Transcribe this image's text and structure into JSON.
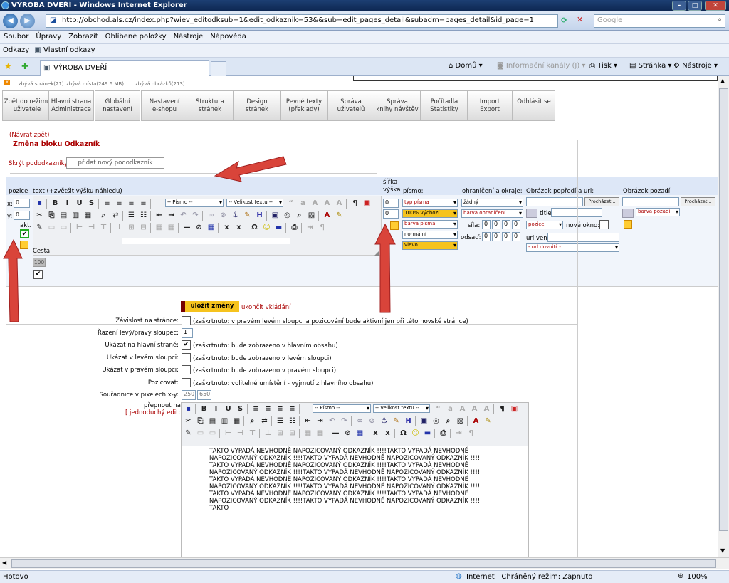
{
  "window": {
    "title": "VÝROBA DVEŘÍ - Windows Internet Explorer"
  },
  "address": {
    "url": "http://obchod.als.cz/index.php?wiev_editodksub=1&edit_odkaznik=53&&sub=edit_pages_detail&subadm=pages_detail&id_page=1",
    "search_placeholder": "Google"
  },
  "menu": [
    "Soubor",
    "Úpravy",
    "Zobrazit",
    "Oblíbené položky",
    "Nástroje",
    "Nápověda"
  ],
  "links_bar": {
    "label": "Odkazy",
    "item": "Vlastní odkazy"
  },
  "tabs": {
    "active": "VÝROBA DVEŘÍ"
  },
  "commands": {
    "home": "Domů",
    "feeds": "Informační kanály (J)",
    "print": "Tisk",
    "page": "Stránka",
    "tools": "Nástroje"
  },
  "quota": {
    "pages": "zbývá stránek(21)",
    "space": "zbývá místa(249.6 MB)",
    "images": "zbývá obrázků(213)"
  },
  "admin_menu": [
    {
      "l1": "Zpět do režimu",
      "l2": "uživatele"
    },
    {
      "l1": "Hlavní strana",
      "l2": "Administrace"
    },
    {
      "l1": "Globální",
      "l2": "nastavení"
    },
    {
      "l1": "Nastavení",
      "l2": "e-shopu"
    },
    {
      "l1": "Struktura",
      "l2": "stránek"
    },
    {
      "l1": "Design",
      "l2": "stránek"
    },
    {
      "l1": "Pevné texty",
      "l2": "(překlady)"
    },
    {
      "l1": "Správa",
      "l2": "uživatelů"
    },
    {
      "l1": "Správa",
      "l2": "knihy návštěv"
    },
    {
      "l1": "Počítadla",
      "l2": "Statistiky"
    },
    {
      "l1": "Import",
      "l2": "Export"
    },
    {
      "l1": "Odhlásit se",
      "l2": ""
    }
  ],
  "form": {
    "back": "(Návrat zpět)",
    "heading": "Změna bloku Odkazník",
    "hide_sub": "Skrýt pododkazníky |",
    "add_sub": "přidat nový pododkazník",
    "hdr_pozice": "pozice",
    "hdr_text": "text (+zvětšit výšku náhledu)",
    "hdr_sirka": "šířka",
    "hdr_vyska": "výška",
    "hdr_pismo": "písmo:",
    "hdr_ohraniceni": "ohraničení a okraje:",
    "hdr_obr_popredi": "Obrázek popředí a url:",
    "hdr_obr_pozadi": "Obrázek pozadí:",
    "x_label": "x:",
    "x_val": "0",
    "y_label": "y:",
    "y_val": "0",
    "akt": "akt.",
    "sirka_val": "0",
    "vyska_val": "0",
    "font_type": "typ písma",
    "font_size": "100% Výchozí",
    "font_color": "barva písma",
    "font_weight": "normální",
    "font_align": "vlevo",
    "border_none": "žádný",
    "border_color": "barva ohraničení",
    "sila": "síla:",
    "odsad": "odsaď:",
    "sila_vals": [
      "0",
      "0",
      "0",
      "0"
    ],
    "odsad_vals": [
      "0",
      "0",
      "0",
      "0"
    ],
    "browse": "Procházet...",
    "title_lbl": "title:",
    "pozice_sel": "pozice",
    "nove_okno": "nové okno:",
    "url_ven": "url ven:",
    "url_dovnitr": "- url dovnitř -",
    "bg_color": "barva pozadí",
    "font_combo": "-- Písmo --",
    "size_combo": "-- Velikost textu --",
    "cesta": "Cesta:",
    "hundred": "100"
  },
  "save": {
    "save_btn": "uložit změny",
    "cancel": "ukončit vkládání"
  },
  "settings": [
    {
      "label": "Závislost na stránce:",
      "desc": "(zaškrtnuto: v pravém levém sloupci a pozicování bude aktivní jen při této hovské stránce)"
    },
    {
      "label": "Řazení levý/pravý sloupec:",
      "value": "1"
    },
    {
      "label": "Ukázat na hlavní straně:",
      "desc": "(zaškrtnuto: bude zobrazeno v hlavním obsahu)"
    },
    {
      "label": "Ukázat v levém sloupci:",
      "desc": "(zaškrtnuto: bude zobrazeno v levém sloupci)"
    },
    {
      "label": "Ukázat v pravém sloupci:",
      "desc": "(zaškrtnuto: bude zobrazeno v pravém sloupci)"
    },
    {
      "label": "Pozicovat:",
      "desc": "(zaškrtnuto: volitelné umístění - vyjmutí z hlavního obsahu)"
    },
    {
      "label": "Souřadnice v pixelech x-y:",
      "x": "250",
      "y": "650"
    }
  ],
  "editor2": {
    "switch1": "přepnout na:",
    "switch2": "[ jednoduchý editor]",
    "lines": [
      "TAKTO VYPADÁ NEVHODNĚ NAPOZICOVANÝ ODKAZNÍK !!!!TAKTO VYPADÁ NEVHODNĚ",
      "NAPOZICOVANÝ ODKAZNÍK !!!!TAKTO VYPADÁ NEVHODNĚ NAPOZICOVANÝ ODKAZNÍK !!!!",
      "TAKTO VYPADÁ NEVHODNĚ NAPOZICOVANÝ ODKAZNÍK !!!!TAKTO VYPADÁ NEVHODNĚ",
      "NAPOZICOVANÝ ODKAZNÍK !!!!TAKTO VYPADÁ NEVHODNĚ NAPOZICOVANÝ ODKAZNÍK !!!!",
      "TAKTO VYPADÁ NEVHODNĚ NAPOZICOVANÝ ODKAZNÍK !!!!TAKTO VYPADÁ NEVHODNĚ",
      "NAPOZICOVANÝ ODKAZNÍK !!!!TAKTO VYPADÁ NEVHODNĚ NAPOZICOVANÝ ODKAZNÍK !!!!",
      "TAKTO VYPADÁ NEVHODNĚ NAPOZICOVANÝ ODKAZNÍK !!!!TAKTO VYPADÁ NEVHODNĚ",
      "NAPOZICOVANÝ ODKAZNÍK !!!!TAKTO VYPADÁ NEVHODNĚ NAPOZICOVANÝ ODKAZNÍK !!!!",
      "TAKTO"
    ]
  },
  "status": {
    "left": "Hotovo",
    "zone": "Internet | Chráněný režim: Zapnuto",
    "zoom": "100%"
  },
  "colors": {
    "accent_red": "#aa0000",
    "save_btn": "#ffcc33",
    "ie_title": "#1d3f73"
  }
}
